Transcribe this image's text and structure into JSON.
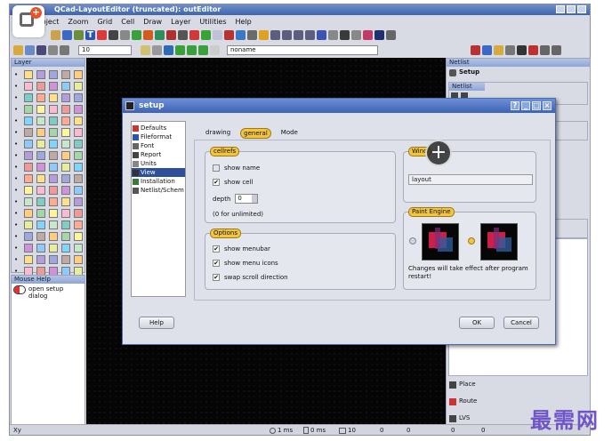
{
  "window": {
    "title": "QCad-LayoutEditor (truncated): outEditor"
  },
  "menubar": [
    "Project",
    "Zoom",
    "Grid",
    "Cell",
    "Draw",
    "Layer",
    "Utilities",
    "Help"
  ],
  "toolbar2": {
    "grid_value": "10",
    "cell_name": "noname"
  },
  "layer_panel": {
    "title": "Layer"
  },
  "mouse_help": {
    "title": "Mouse Help",
    "text_line1": "open setup",
    "text_line2": "dialog"
  },
  "netlist": {
    "title": "Netlist",
    "setup_label": "Setup",
    "inner_title": "Netlist"
  },
  "right_bottom": {
    "place": "Place",
    "route": "Route",
    "lvs": "LVS"
  },
  "statusbar": {
    "left": "Xy",
    "t1": "1 ms",
    "t2": "0 ms",
    "grid": "10",
    "a": "0",
    "b": "0",
    "c": "0",
    "d": "0"
  },
  "dialog": {
    "title": "setup",
    "nav": [
      "Defaults",
      "Fileformat",
      "Font",
      "Report",
      "Units",
      "View",
      "Installation",
      "Netlist/Schem"
    ],
    "nav_selected": "View",
    "tabs": [
      "drawing",
      "general",
      "Mode"
    ],
    "active_tab": "general",
    "cellrefs": {
      "label": "cellrefs",
      "show_name": "show name",
      "show_name_checked": false,
      "show_cell": "show cell",
      "show_cell_checked": true,
      "depth_label": "depth",
      "depth_value": "0",
      "depth_note": "(0 for unlimited)"
    },
    "options": {
      "label": "Options",
      "show_menubar": "show menubar",
      "show_menu_icons": "show menu icons",
      "swap_scroll": "swap scroll direction"
    },
    "window_group": {
      "label": "Wind",
      "combo_value": "layout"
    },
    "paint_engine": {
      "label": "Paint Engine",
      "note": "Changes will take effect after program restart!"
    },
    "help_button": "Help",
    "ok_button": "OK",
    "cancel_button": "Cancel"
  },
  "watermark": "最需网",
  "colors": {
    "accent_yellow": "#f3c442",
    "title_blue": "#3d63b4",
    "canvas": "#050505"
  }
}
